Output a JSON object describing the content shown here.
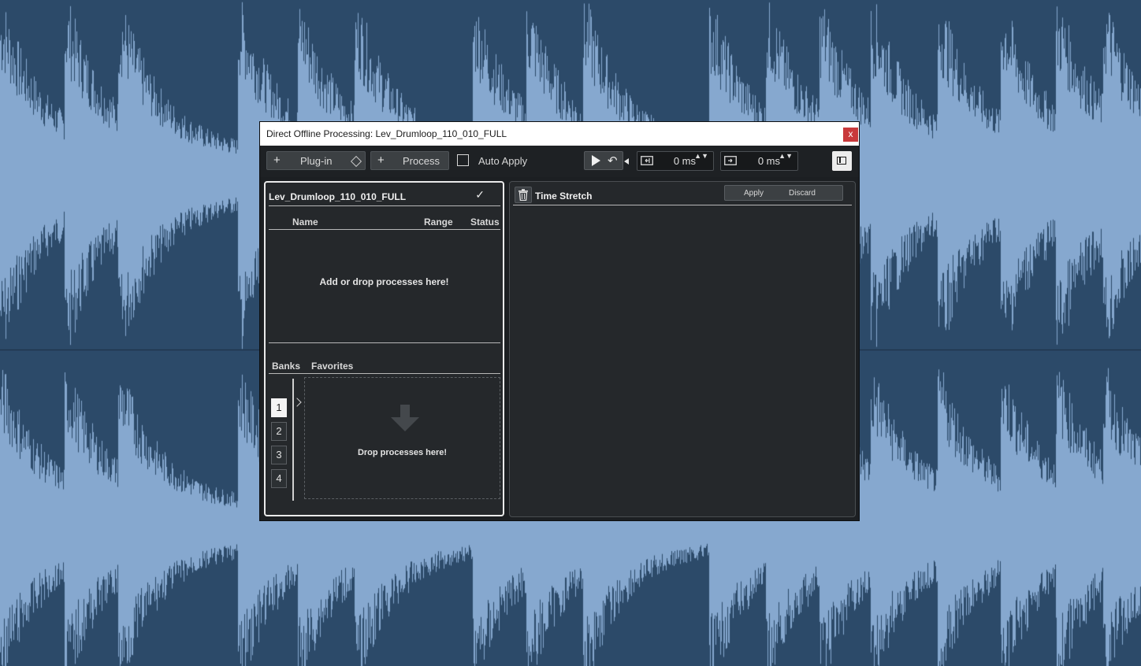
{
  "window": {
    "title": "Direct Offline Processing: Lev_Drumloop_110_010_FULL",
    "close_glyph": "x"
  },
  "toolbar": {
    "plugin_label": "Plug-in",
    "process_label": "Process",
    "add_glyph": "+",
    "auto_apply_label": "Auto Apply",
    "auto_apply_checked": false,
    "pre_roll": "0 ms",
    "post_roll": "0 ms",
    "spin_glyph": "▲▼"
  },
  "process_list": {
    "clip_name": "Lev_Drumloop_110_010_FULL",
    "check_glyph": "✓",
    "columns": [
      "Name",
      "Range",
      "Status"
    ],
    "empty_message": "Add or drop processes here!"
  },
  "favorites": {
    "tabs": [
      "Banks",
      "Favorites"
    ],
    "banks": [
      "1",
      "2",
      "3",
      "4"
    ],
    "active_bank": "1",
    "drop_message": "Drop processes here!"
  },
  "process_editor": {
    "title": "Time Stretch",
    "apply_label": "Apply",
    "discard_label": "Discard"
  },
  "colors": {
    "background": "#2c4a69",
    "waveform": "#86a8cf",
    "dialog": "#1c1f22",
    "close_button": "#c8393b"
  }
}
